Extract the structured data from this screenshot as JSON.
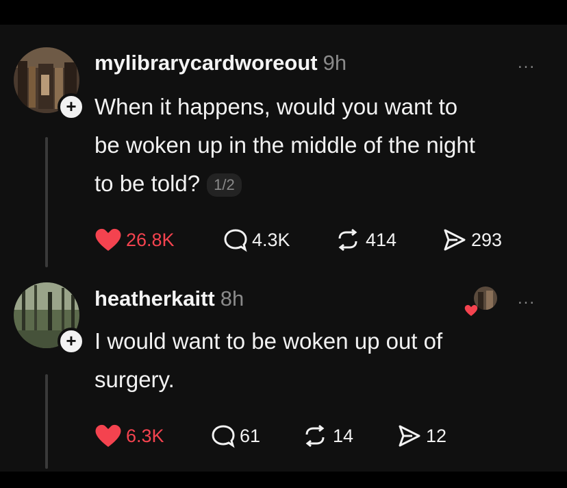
{
  "colors": {
    "background": "#101010",
    "like": "#f4434f",
    "muted": "#8a8a8a",
    "text": "#f2f2f2"
  },
  "posts": [
    {
      "username": "mylibrarycardworeout",
      "time": "9h",
      "more": "...",
      "lines": [
        "When it happens, would you want to",
        "be woken up in the middle of the night",
        "to be told?"
      ],
      "pager": "1/2",
      "likes": "26.8K",
      "comments": "4.3K",
      "reposts": "414",
      "shares": "293"
    },
    {
      "username": "heatherkaitt",
      "time": "8h",
      "more": "...",
      "lines": [
        "I would want to be woken up out of",
        "surgery."
      ],
      "likes": "6.3K",
      "comments": "61",
      "reposts": "14",
      "shares": "12"
    }
  ],
  "icons": [
    "avatar-photo-icon",
    "follow-plus-icon",
    "heart-icon",
    "comment-icon",
    "repost-icon",
    "share-icon",
    "more-icon"
  ]
}
